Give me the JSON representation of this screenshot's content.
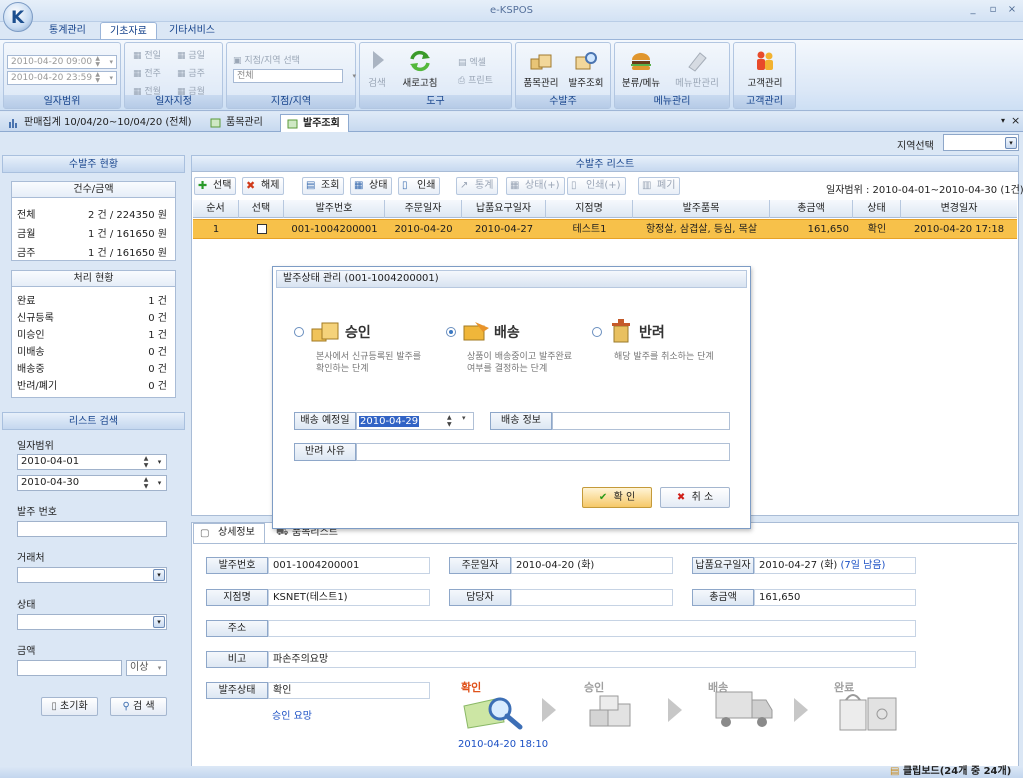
{
  "app": {
    "title": "e-KSPOS",
    "logo": "K"
  },
  "window_buttons": [
    "_",
    "▫",
    "×"
  ],
  "ribbon_tabs": [
    "통계관리",
    "기초자료",
    "기타서비스"
  ],
  "ribbon": {
    "date_from": "2010-04-20 09:00",
    "date_to": "2010-04-20 23:59",
    "date_group": "일자범위",
    "date_spec": {
      "items": [
        "전일",
        "금일",
        "전주",
        "금주",
        "전월",
        "금월"
      ],
      "group": "일자지정"
    },
    "region": {
      "select_label": "지점/지역 선택",
      "value": "전체",
      "group": "지점/지역"
    },
    "tools": {
      "search": "검색",
      "refresh": "새로고침",
      "excel": "엑셀",
      "print": "프린트",
      "group": "도구"
    },
    "order": {
      "item_mgmt": "품목관리",
      "order_lookup": "발주조회",
      "group": "수발주"
    },
    "menu": {
      "category_menu": "분류/메뉴",
      "menu_mgmt": "메뉴판관리",
      "group": "메뉴관리"
    },
    "customer": {
      "customer_mgmt": "고객관리",
      "group": "고객관리"
    }
  },
  "doc_tabs": [
    "판매집계 10/04/20~10/04/20 (전체)",
    "품목관리",
    "발주조회"
  ],
  "region_select_label": "지역선택",
  "left": {
    "status_header": "수발주 현황",
    "count_box": {
      "title": "건수/금액",
      "rows": [
        {
          "k": "전체",
          "v": "2 건 / 224350 원"
        },
        {
          "k": "금월",
          "v": "1 건 / 161650 원"
        },
        {
          "k": "금주",
          "v": "1 건 / 161650 원"
        }
      ]
    },
    "process_box": {
      "title": "처리 현황",
      "rows": [
        {
          "k": "완료",
          "v": "1 건"
        },
        {
          "k": "신규등록",
          "v": "0 건"
        },
        {
          "k": "미승인",
          "v": "1 건"
        },
        {
          "k": "미배송",
          "v": "0 건"
        },
        {
          "k": "배송중",
          "v": "0 건"
        },
        {
          "k": "반려/폐기",
          "v": "0 건"
        }
      ]
    },
    "search_header": "리스트 검색",
    "date_range_label": "일자범위",
    "date_from": "2010-04-01",
    "date_to": "2010-04-30",
    "order_no_label": "발주 번호",
    "vendor_label": "거래처",
    "status_label": "상태",
    "amount_label": "금액",
    "amount_cond": "이상",
    "reset_button": "초기화",
    "search_button": "검 색"
  },
  "list": {
    "header": "수발주 리스트",
    "toolbar": [
      "선택",
      "해제",
      "조회",
      "상태",
      "인쇄",
      "통계",
      "상태(+)",
      "인쇄(+)",
      "폐기"
    ],
    "date_range": "일자범위 : 2010-04-01~2010-04-30 (1건)",
    "columns": [
      "순서",
      "선택",
      "발주번호",
      "주문일자",
      "납품요구일자",
      "지점명",
      "발주품목",
      "총금액",
      "상태",
      "변경일자"
    ],
    "rows": [
      {
        "seq": "1",
        "order_no": "001-1004200001",
        "order_date": "2010-04-20",
        "due_date": "2010-04-27",
        "branch": "테스트1",
        "items": "항정살, 삼겹살, 등심, 목살",
        "total": "161,650",
        "status": "확인",
        "changed": "2010-04-20 17:18"
      }
    ]
  },
  "modal": {
    "title": "발주상태 관리 (001-1004200001)",
    "options": [
      {
        "title": "승인",
        "desc1": "본사에서 신규등록된 발주를",
        "desc2": "확인하는 단계"
      },
      {
        "title": "배송",
        "desc1": "상품이 배송중이고 발주완료",
        "desc2": "여부를 결정하는 단계"
      },
      {
        "title": "반려",
        "desc1": "해당 발주를 취소하는 단계",
        "desc2": ""
      }
    ],
    "selected": "배송",
    "ship_date_label": "배송 예정일",
    "ship_date": "2010-04-29",
    "ship_info_label": "배송 정보",
    "reject_label": "반려 사유",
    "ok_button": "확 인",
    "cancel_button": "취 소"
  },
  "detail": {
    "tabs": [
      "상세정보",
      "품목리스트"
    ],
    "order_no_label": "발주번호",
    "order_no": "001-1004200001",
    "order_date_label": "주문일자",
    "order_date": "2010-04-20 (화)",
    "due_label": "납품요구일자",
    "due": "2010-04-27 (화)",
    "due_remaining": "(7일 남음)",
    "branch_label": "지점명",
    "branch": "KSNET(테스트1)",
    "manager_label": "담당자",
    "manager": "",
    "total_label": "총금액",
    "total": "161,650",
    "address_label": "주소",
    "address": "",
    "note_label": "비고",
    "note": "파손주의요망",
    "status_label": "발주상태",
    "status": "확인",
    "approval_request": "승인 요망",
    "steps": [
      "확인",
      "승인",
      "배송",
      "완료"
    ],
    "step_date": "2010-04-20 18:10"
  },
  "status_bar": {
    "clipboard": "클립보드(24개 중 24개)"
  }
}
